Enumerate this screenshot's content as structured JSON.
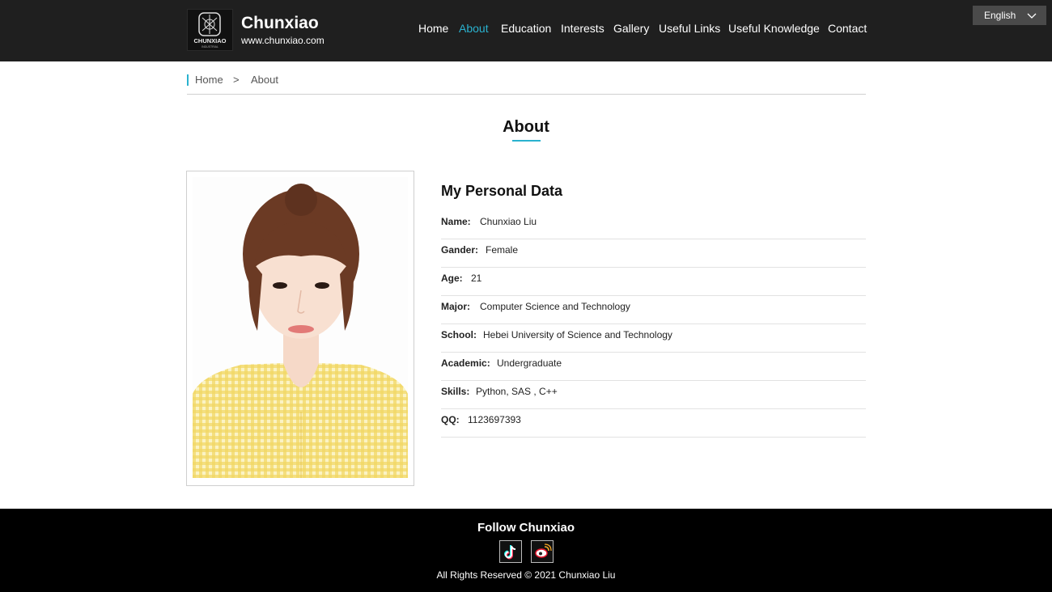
{
  "header": {
    "logo_text": "CHUNXIAO",
    "logo_subtext": "INDUSTRIAL",
    "site_name": "Chunxiao",
    "site_url": "www.chunxiao.com",
    "nav": [
      {
        "label": "Home",
        "active": false
      },
      {
        "label": "About",
        "active": true
      },
      {
        "label": "Education",
        "active": false
      },
      {
        "label": "Interests",
        "active": false
      },
      {
        "label": "Gallery",
        "active": false
      },
      {
        "label": "Useful Links",
        "active": false
      },
      {
        "label": "Useful Knowledge",
        "active": false
      },
      {
        "label": "Contact",
        "active": false
      }
    ],
    "language": "English",
    "language_icon": "chevron-down-icon"
  },
  "breadcrumb": {
    "home": "Home",
    "separator": ">",
    "current": "About"
  },
  "page_title": "About",
  "profile": {
    "photo_icon": "portrait-photo",
    "section_title": "My Personal Data",
    "fields": [
      {
        "label": "Name:",
        "value": "Chunxiao Liu"
      },
      {
        "label": "Gander:",
        "value": "Female"
      },
      {
        "label": "Age:",
        "value": "21"
      },
      {
        "label": "Major:",
        "value": "Computer Science and Technology"
      },
      {
        "label": "School:",
        "value": "Hebei University of Science and Technology"
      },
      {
        "label": "Academic:",
        "value": "Undergraduate"
      },
      {
        "label": "Skills:",
        "value": "Python, SAS , C++"
      },
      {
        "label": "QQ:",
        "value": "1123697393"
      }
    ]
  },
  "footer": {
    "follow": "Follow Chunxiao",
    "social_icons": [
      "tiktok-icon",
      "weibo-icon"
    ],
    "copyright": "All Rights Reserved © 2021 Chunxiao Liu"
  },
  "colors": {
    "accent": "#2ab2cf",
    "header_bg": "#1f1f1f",
    "footer_bg": "#000000"
  }
}
